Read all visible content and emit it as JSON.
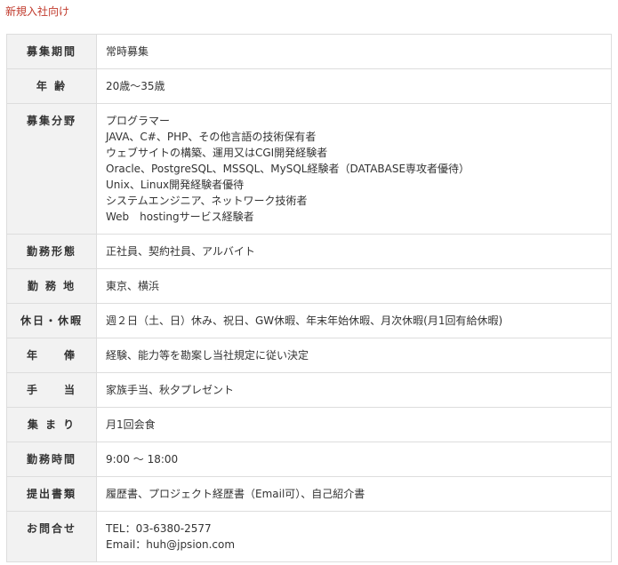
{
  "section_title": "新規入社向け",
  "rows": [
    {
      "label": "募集期間",
      "lines": [
        "常時募集"
      ]
    },
    {
      "label": "年 齢",
      "lines": [
        "20歳〜35歳"
      ]
    },
    {
      "label": "募集分野",
      "lines": [
        "プログラマー",
        "JAVA、C#、PHP、その他言語の技術保有者",
        "ウェブサイトの構築、運用又はCGI開発経験者",
        "Oracle、PostgreSQL、MSSQL、MySQL経験者（DATABASE専攻者優待）",
        "Unix、Linux開発経験者優待",
        "システムエンジニア、ネットワーク技術者",
        "Web　hostingサービス経験者"
      ]
    },
    {
      "label": "勤務形態",
      "lines": [
        "正社員、契約社員、アルバイト"
      ]
    },
    {
      "label": "勤 務 地",
      "lines": [
        "東京、横浜"
      ]
    },
    {
      "label": "休日・休暇",
      "lines": [
        "週２日（土、日）休み、祝日、GW休暇、年末年始休暇、月次休暇(月1回有給休暇)"
      ]
    },
    {
      "label": "年　　俸",
      "lines": [
        "経験、能力等を勘案し当社規定に従い決定"
      ]
    },
    {
      "label": "手　　当",
      "lines": [
        "家族手当、秋夕プレゼント"
      ]
    },
    {
      "label": "集 ま り",
      "lines": [
        "月1回会食"
      ]
    },
    {
      "label": "勤務時間",
      "lines": [
        "9:00 〜 18:00"
      ]
    },
    {
      "label": "提出書類",
      "lines": [
        "履歴書、プロジェクト経歴書（Email可）、自己紹介書"
      ]
    },
    {
      "label": "お問合せ",
      "lines": [
        "TEL：03-6380-2577",
        "Email：huh@jpsion.com"
      ]
    }
  ]
}
